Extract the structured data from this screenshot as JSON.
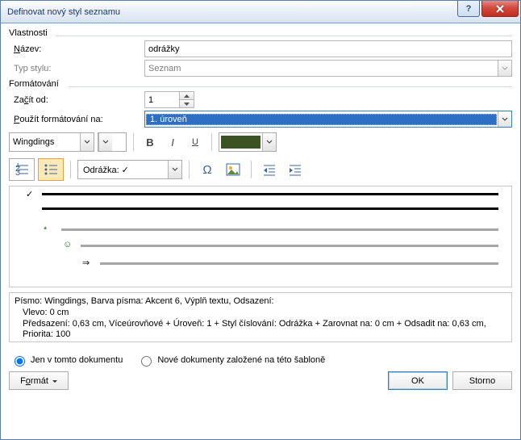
{
  "window": {
    "title": "Definovat nový styl seznamu"
  },
  "groups": {
    "props": "Vlastnosti",
    "format": "Formátování"
  },
  "labels": {
    "name": "Název:",
    "styleType": "Typ stylu:",
    "startAt": "Začít od:",
    "applyTo": "Použít formátování na:"
  },
  "fields": {
    "name": "odrážky",
    "styleType": "Seznam",
    "startAt": "1",
    "applyTo": "1. úroveň",
    "font": "Wingdings",
    "bullet": "Odrážka:  ✓",
    "colorHex": "#3b5323"
  },
  "description": {
    "l1": "Písmo: Wingdings, Barva písma: Akcent 6, Výplň textu, Odsazení:",
    "l2": "Vlevo:  0 cm",
    "l3": "Předsazení:  0,63 cm, Víceúrovňové + Úroveň: 1 + Styl číslování: Odrážka + Zarovnat na:  0 cm + Odsadit na:  0,63 cm, Priorita: 100"
  },
  "radios": {
    "doc": "Jen v tomto dokumentu",
    "template": "Nové dokumenty založené na této šabloně"
  },
  "buttons": {
    "format": "Formát",
    "ok": "OK",
    "cancel": "Storno"
  },
  "chart_data": null
}
